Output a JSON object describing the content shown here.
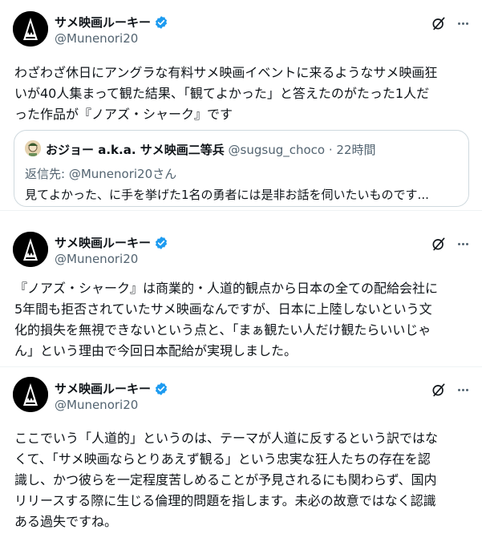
{
  "tweets": [
    {
      "author": {
        "name": "サメ映画ルーキー",
        "handle": "@Munenori20"
      },
      "lines": [
        "わざわざ休日にアングラな有料サメ映画イベントに来るようなサメ映画狂",
        "いが40人集まって観た結果、「観てよかった」と答えたのがたった1人だ",
        "った作品が『ノアズ・シャーク』です"
      ],
      "quote": {
        "name": "おジョー a.k.a. サメ映画二等兵",
        "handle": "@sugsug_choco",
        "separator": " · ",
        "time": "22時間",
        "reply_to": "返信先: @Munenori20さん",
        "text": "見てよかった、に手を挙げた1名の勇者には是非お話を伺いたいものです..."
      }
    },
    {
      "author": {
        "name": "サメ映画ルーキー",
        "handle": "@Munenori20"
      },
      "lines": [
        "『ノアズ・シャーク』は商業的・人道的観点から日本の全ての配給会社に",
        "5年間も拒否されていたサメ映画なんですが、日本に上陸しないという文",
        "化的損失を無視できないという点と、「まぁ観たい人だけ観たらいいじゃ",
        "ん」という理由で今回日本配給が実現しました。"
      ]
    },
    {
      "author": {
        "name": "サメ映画ルーキー",
        "handle": "@Munenori20"
      },
      "lines": [
        "ここでいう「人道的」というのは、テーマが人道に反するという訳ではな",
        "くて、「サメ映画ならとりあえず観る」という忠実な狂人たちの存在を認",
        "識し、かつ彼らを一定程度苦しめることが予見されるにも関わらず、国内",
        "リリースする際に生じる倫理的問題を指します。未必の故意ではなく認識",
        "ある過失ですね。"
      ]
    }
  ],
  "icons": [
    "shark-avatar-icon",
    "verified-badge-icon",
    "grok-icon",
    "more-icon",
    "quote-avatar-icon"
  ],
  "colors": {
    "verified": "#1d9bf0",
    "secondary_text": "#536471",
    "border": "#cfd9de"
  }
}
